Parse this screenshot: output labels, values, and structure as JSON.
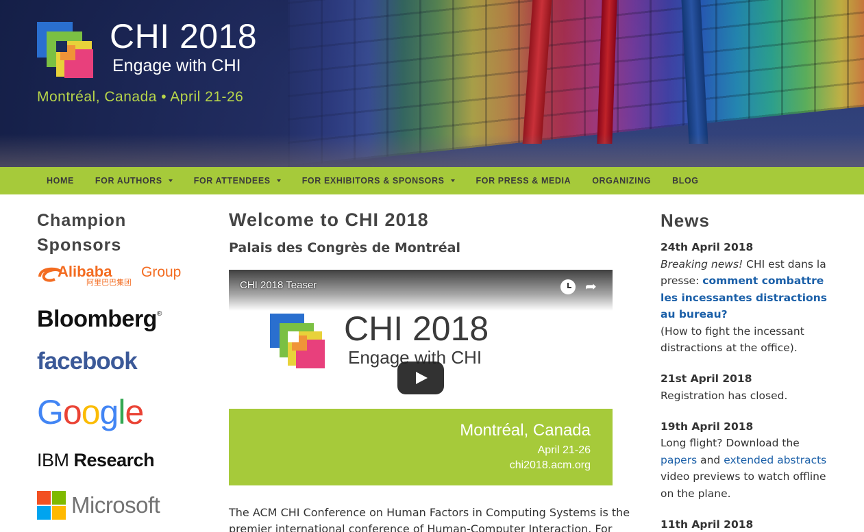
{
  "header": {
    "title": "CHI 2018",
    "subtitle": "Engage with CHI",
    "location": "Montréal, Canada • April 21-26"
  },
  "nav": {
    "items": [
      {
        "label": "HOME",
        "dropdown": false
      },
      {
        "label": "FOR AUTHORS",
        "dropdown": true
      },
      {
        "label": "FOR ATTENDEES",
        "dropdown": true
      },
      {
        "label": "FOR EXHIBITORS & SPONSORS",
        "dropdown": true
      },
      {
        "label": "FOR PRESS & MEDIA",
        "dropdown": false
      },
      {
        "label": "ORGANIZING",
        "dropdown": false
      },
      {
        "label": "BLOG",
        "dropdown": false
      }
    ]
  },
  "sponsors": {
    "heading": "Champion Sponsors",
    "alibaba": {
      "name": "Alibaba",
      "group": "Group",
      "chinese": "阿里巴巴集团"
    },
    "bloomberg": "Bloomberg",
    "facebook": "facebook",
    "google": "Google",
    "ibm": {
      "a": "IBM",
      "b": "Research"
    },
    "microsoft": "Microsoft"
  },
  "main": {
    "title": "Welcome to CHI 2018",
    "subtitle": "Palais des Congrès de Montréal",
    "video": {
      "title": "CHI 2018 Teaser",
      "big_title": "CHI 2018",
      "big_sub": "Engage with CHI",
      "city": "Montréal, Canada",
      "dates": "April 21-26",
      "url": "chi2018.acm.org"
    },
    "intro": "The ACM CHI Conference on Human Factors in Computing Systems is the premier international conference of Human-Computer Interaction. For first-"
  },
  "news": {
    "heading": "News",
    "items": [
      {
        "date": "24th April 2018",
        "lead_em": "Breaking news!",
        "text1": " CHI est dans la presse: ",
        "link": "comment combattre les incessantes distractions au bureau?",
        "text2": "(How to fight the incessant distractions at the office)."
      },
      {
        "date": "21st April 2018",
        "text": "Registration has closed."
      },
      {
        "date": "19th April 2018",
        "text1": "Long flight? Download the ",
        "link1": "papers",
        "mid": " and ",
        "link2": "extended abstracts",
        "text2": " video previews to watch offline on the plane."
      },
      {
        "date": "11th April 2018"
      }
    ]
  },
  "colors": {
    "nav_green": "#a6ca3a",
    "location_green": "#b8d64a",
    "link_blue": "#1a5fa8",
    "facebook_blue": "#3b5998"
  }
}
